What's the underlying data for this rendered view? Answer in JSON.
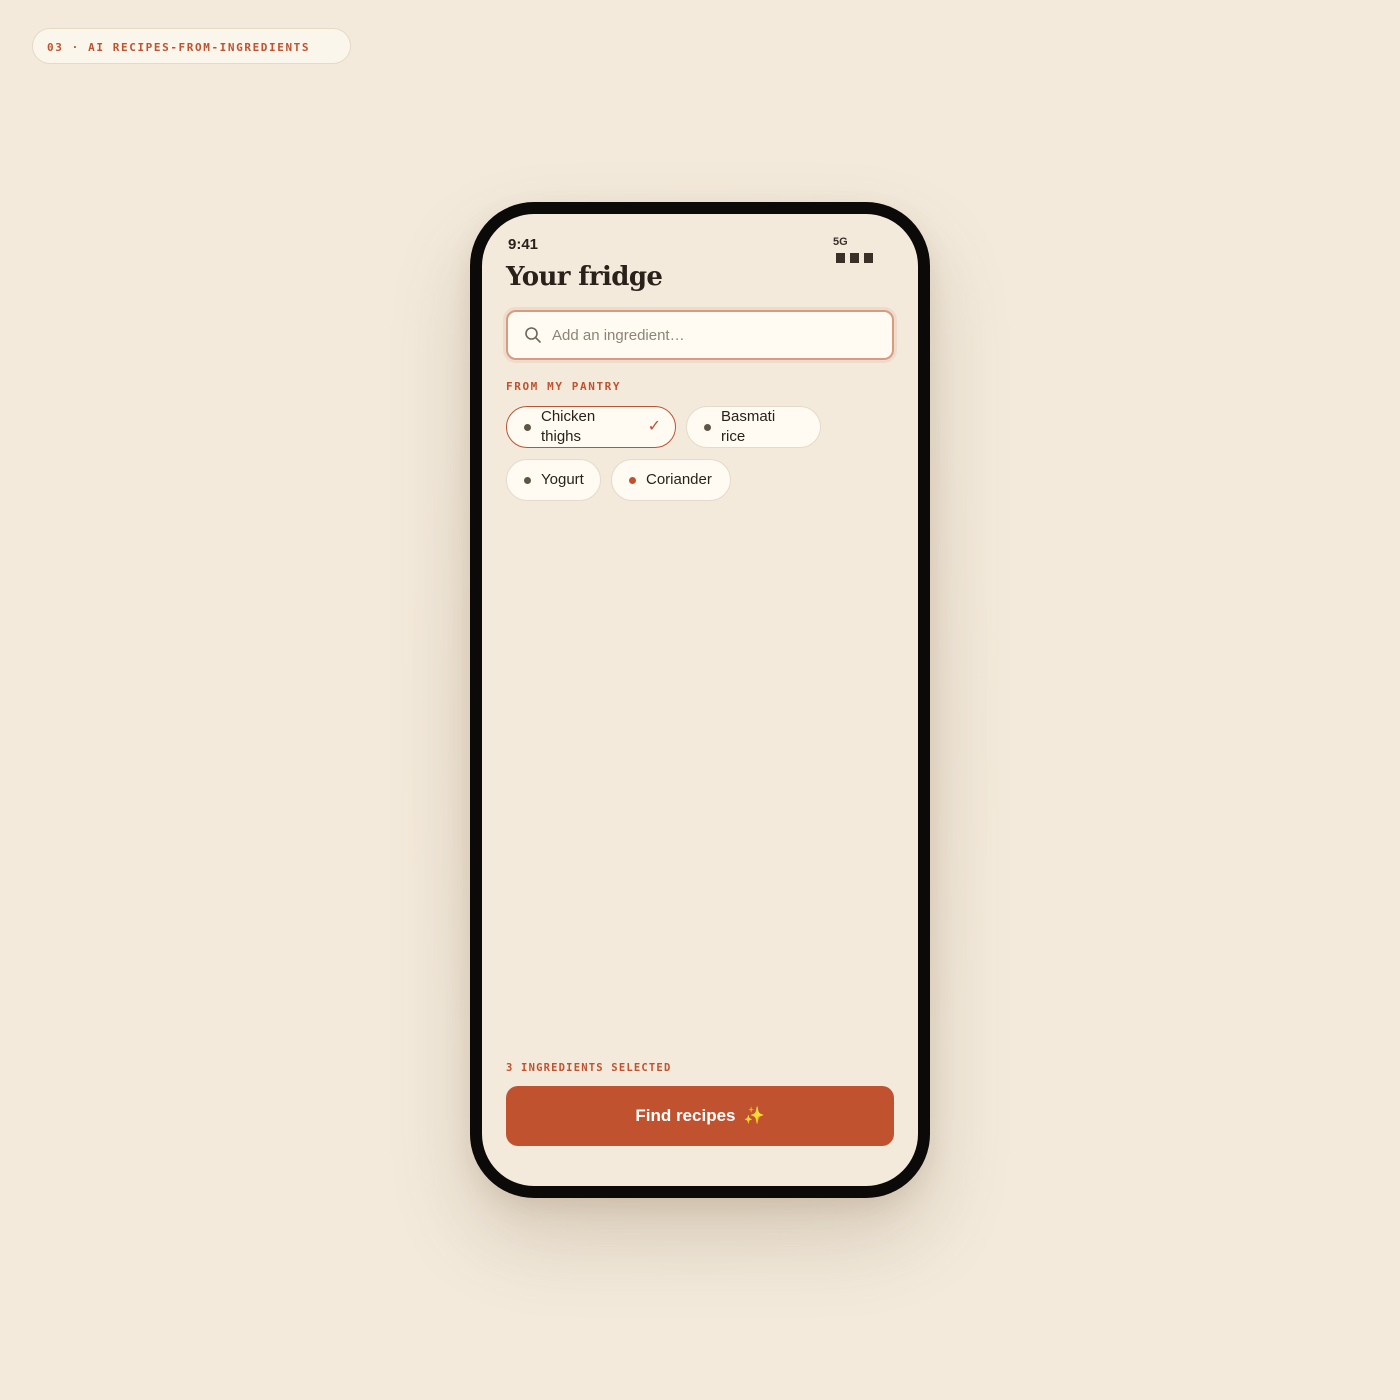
{
  "tag": {
    "text": "03 · AI RECIPES-FROM-INGREDIENTS"
  },
  "status": {
    "time": "9:41",
    "network": "5G",
    "signal_icon": "signal-bars-icon"
  },
  "header": {
    "title": "Your fridge"
  },
  "search": {
    "placeholder": "Add an ingredient…",
    "value": "",
    "icon": "search-icon"
  },
  "pantry": {
    "label": "FROM MY PANTRY",
    "items": [
      {
        "label": "Chicken thighs",
        "selected": true,
        "check_icon": "checkmark-icon"
      },
      {
        "label": "Basmati rice",
        "selected": false
      },
      {
        "label": "Yogurt",
        "selected": false
      },
      {
        "label": "Coriander",
        "selected": false
      }
    ]
  },
  "footer": {
    "count_text": "3 INGREDIENTS SELECTED",
    "cta_label": "Find recipes",
    "cta_icon": "sparkles-icon",
    "check_glyph": "✓",
    "sparkle_glyph": "✨"
  },
  "colors": {
    "background": "#f3eadc",
    "accent": "#c0522f",
    "text": "#2a211b",
    "chip_bg": "#fffbf3",
    "dot_neutral": "#5f5546"
  }
}
